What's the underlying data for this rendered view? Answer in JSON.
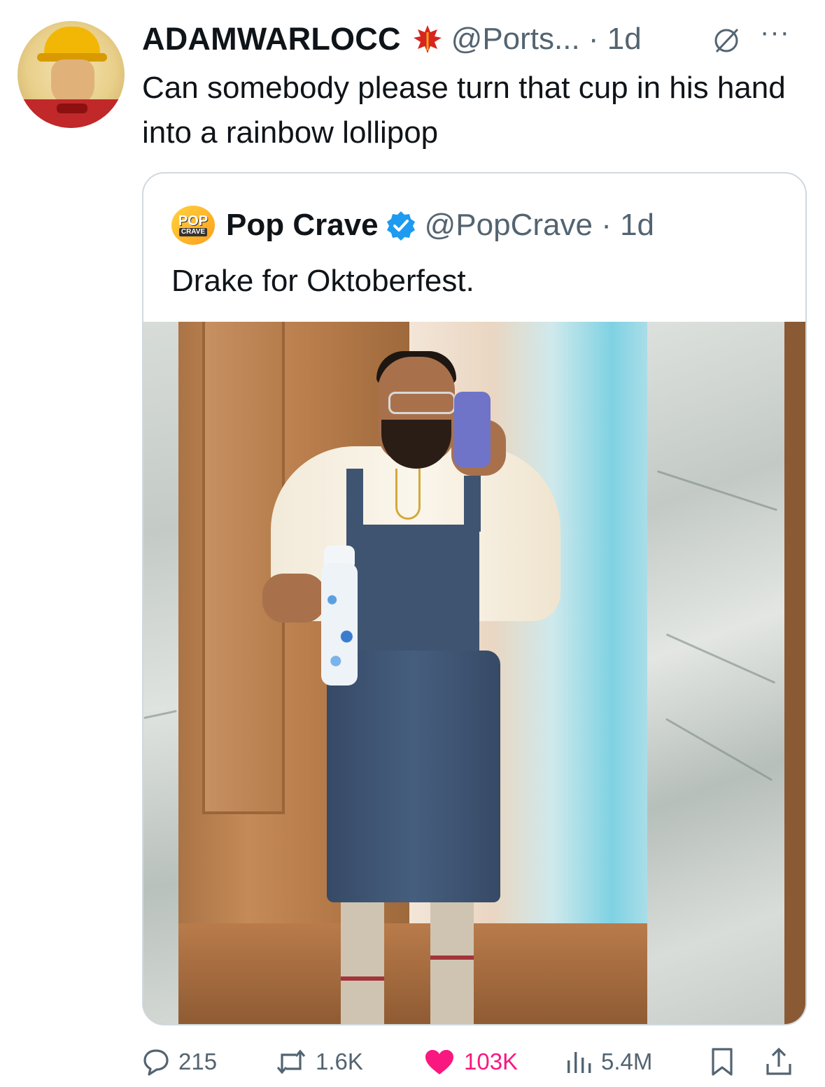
{
  "tweet": {
    "author_name": "ADAMWARLOCC",
    "meta": "@Ports... · 1d",
    "text": "Can somebody please turn that cup in his hand into a rainbow lollipop",
    "more": "···"
  },
  "quote": {
    "author_name": "Pop Crave",
    "logo_line1": "POP",
    "logo_line2": "CRAVE",
    "meta": "@PopCrave · 1d",
    "text": "Drake for Oktoberfest."
  },
  "actions": {
    "replies": "215",
    "reposts": "1.6K",
    "likes": "103K",
    "views": "5.4M"
  },
  "colors": {
    "secondary_text": "#536471",
    "verified_blue": "#1d9bf0",
    "like_pink": "#f91880",
    "border": "#cfd9de"
  },
  "icons": [
    "leaf-badge-icon",
    "grok-icon",
    "more-icon",
    "verified-icon",
    "reply-icon",
    "repost-icon",
    "like-icon",
    "views-icon",
    "bookmark-icon",
    "share-icon"
  ]
}
